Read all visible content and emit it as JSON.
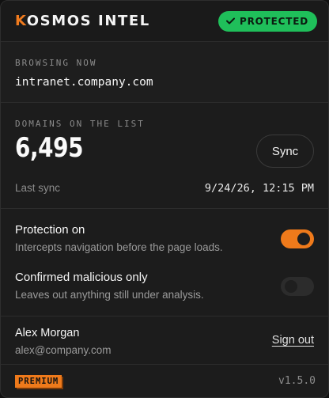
{
  "header": {
    "brand_accent": "K",
    "brand_rest": "OSMOS INTEL",
    "status_label": "PROTECTED",
    "status_icon": "check-icon"
  },
  "browsing": {
    "label": "BROWSING NOW",
    "url": "intranet.company.com"
  },
  "domains": {
    "label": "DOMAINS ON THE LIST",
    "count": "6,495",
    "sync_label": "Sync",
    "last_sync_label": "Last sync",
    "last_sync_time": "9/24/26, 12:15 PM"
  },
  "toggles": [
    {
      "title": "Protection on",
      "description": "Intercepts navigation before the page loads.",
      "enabled": true
    },
    {
      "title": "Confirmed malicious only",
      "description": "Leaves out anything still under analysis.",
      "enabled": false
    }
  ],
  "account": {
    "name": "Alex Morgan",
    "email": "alex@company.com",
    "sign_out_label": "Sign out"
  },
  "footer": {
    "plan_badge": "PREMIUM",
    "version": "v1.5.0"
  },
  "colors": {
    "accent": "#ef7a1b",
    "protected_green": "#1fbf5a",
    "background": "#1c1c1c"
  }
}
